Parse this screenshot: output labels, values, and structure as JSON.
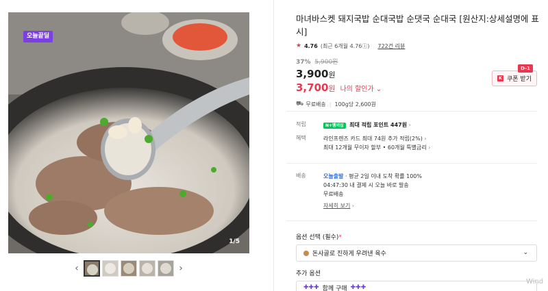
{
  "gallery": {
    "badge": "오늘끝딜",
    "counter": "1/5",
    "thumbs": [
      "thumb-1",
      "thumb-2",
      "thumb-3",
      "thumb-4",
      "thumb-5"
    ],
    "prev_icon": "‹",
    "next_icon": "›"
  },
  "product": {
    "title": "마녀바스켓 돼지국밥 순대국밥 순댓국 순대국 [원산지:상세설명에 표시]",
    "rating": "4.76",
    "rating_recent": "(최근 6개월 4.76ⓘ)",
    "reviews": "722건 리뷰",
    "discount_rate": "37%",
    "original_price": "5,900원",
    "price": "3,900",
    "price_unit": "원",
    "my_price": "3,700",
    "my_price_unit": "원",
    "my_price_label": "나의 할인가 ⌄",
    "coupon_label": "쿠폰 받기",
    "coupon_tag": "D-1",
    "shipping": "무료배송",
    "unit_price": "100g당 2,600원"
  },
  "specs": {
    "points_label": "적립",
    "points_badge": "N+멤버십",
    "points_text": "최대 적립 포인트 447원",
    "benefit_label": "혜택",
    "benefit_line1": "라인프렌즈 카드 최대 74원 추가 적립(2%)",
    "benefit_line2": "최대 12개월 무이자 할부 • 60개월 특별금리",
    "delivery_label": "배송",
    "delivery_link": "오늘출발",
    "delivery_line1": "· 평균 2일 이내 도착 확률 100%",
    "delivery_line2": "04:47:30  내 결제 시 오늘 바로 발송",
    "delivery_line3": "무료배송",
    "detail_link": "자세히 보기"
  },
  "options": {
    "required_label": "옵션 선택 (필수)",
    "required_mark": "*",
    "selected_value": "돈사골로 진하게 우려낸 육수",
    "extra_label": "추가 옵션",
    "extra_value": "함께 구매"
  },
  "watermark": "Wind",
  "colors": {
    "accent": "#e8384f",
    "badge": "#7b3fe4",
    "link": "#2b6fd6",
    "npay": "#03c75a"
  }
}
